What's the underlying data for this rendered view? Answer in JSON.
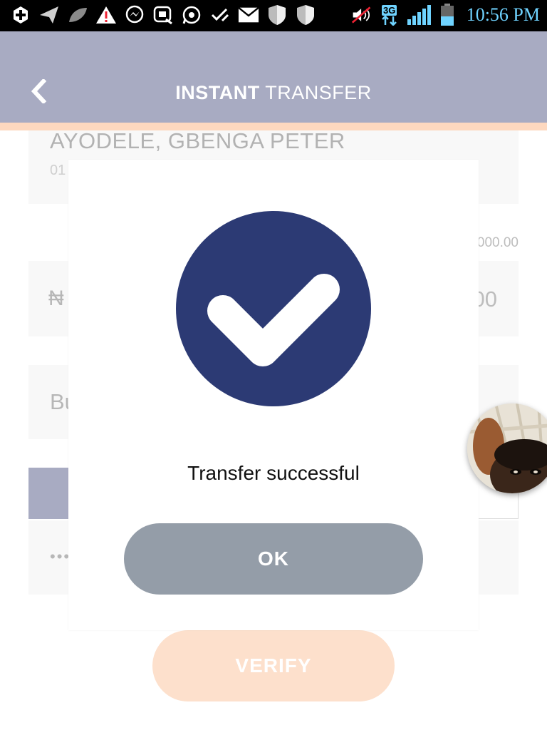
{
  "status_bar": {
    "time": "10:56 PM",
    "network_label": "3G",
    "left_icons": [
      "add-icon",
      "send-icon",
      "leaf-icon",
      "warning-icon",
      "messenger-icon",
      "messaging-icon",
      "whatsapp-icon",
      "check-icon",
      "mail-icon",
      "shield-icon",
      "shield-icon"
    ],
    "right_icons": [
      "mute-icon",
      "network-3g-icon",
      "signal-icon",
      "battery-icon"
    ]
  },
  "header": {
    "title_bold": "INSTANT",
    "title_rest": " TRANSFER",
    "background": "#a8abc2",
    "accent": "#fdd8bf"
  },
  "form": {
    "recipient_name": "AYODELE, GBENGA PETER",
    "recipient_account_partial": "01",
    "balance_note_partial": "000.00",
    "currency_symbol": "₦",
    "amount_partial": "00",
    "bank_partial": "Bu",
    "pin_masked": "•••",
    "verify_label": "VERIFY"
  },
  "dialog": {
    "message": "Transfer successful",
    "ok_label": "OK",
    "icon": "checkmark-icon",
    "icon_color": "#2c3a74",
    "button_color": "#949da8"
  }
}
